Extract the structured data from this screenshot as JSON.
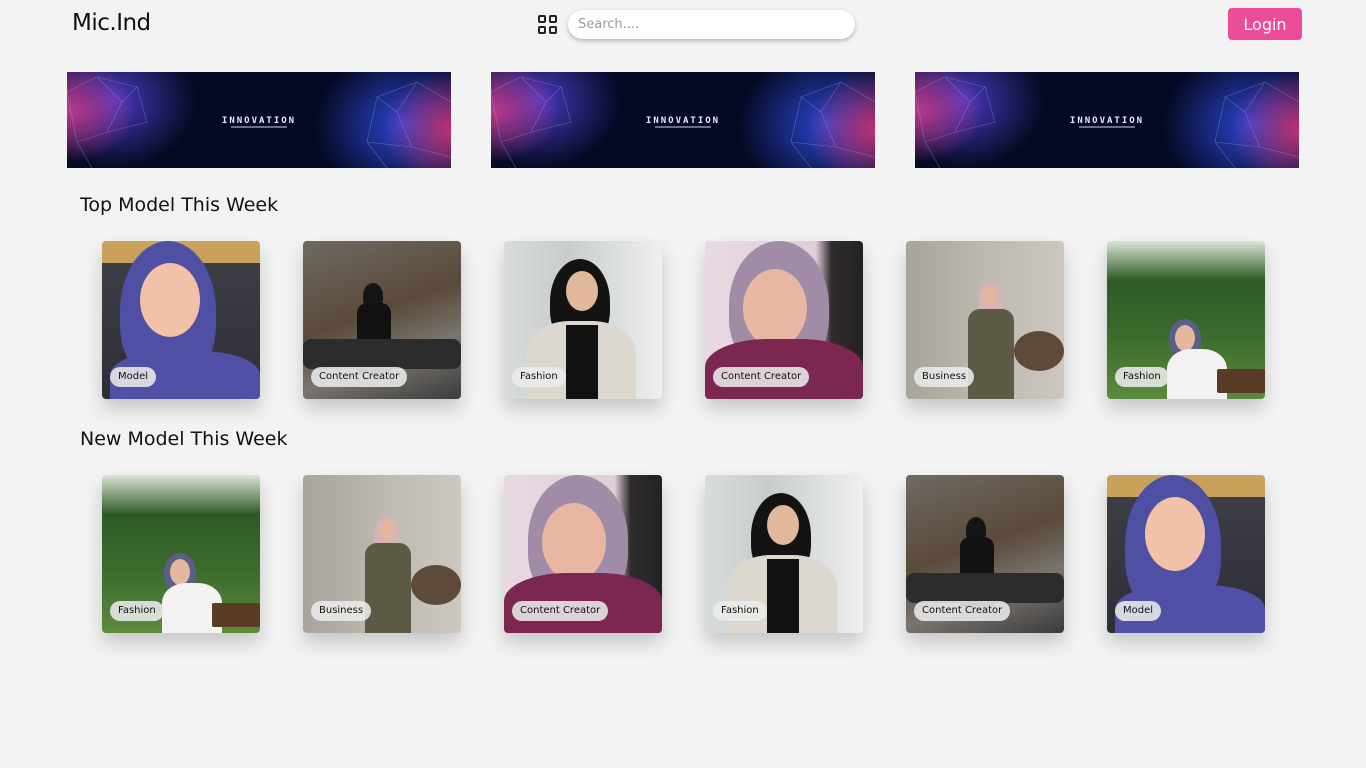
{
  "header": {
    "brand": "Mic.Ind",
    "search_placeholder": "Search....",
    "login_label": "Login",
    "grid_icon": "grid-icon"
  },
  "banners": [
    {
      "text": "INNOVATION"
    },
    {
      "text": "INNOVATION"
    },
    {
      "text": "INNOVATION"
    }
  ],
  "sections": {
    "top": {
      "title": "Top Model This Week",
      "cards": [
        {
          "tag": "Model"
        },
        {
          "tag": "Content Creator"
        },
        {
          "tag": "Fashion"
        },
        {
          "tag": "Content Creator"
        },
        {
          "tag": "Business"
        },
        {
          "tag": "Fashion"
        }
      ]
    },
    "new": {
      "title": "New Model This Week",
      "cards": [
        {
          "tag": "Fashion"
        },
        {
          "tag": "Business"
        },
        {
          "tag": "Content Creator"
        },
        {
          "tag": "Fashion"
        },
        {
          "tag": "Content Creator"
        },
        {
          "tag": "Model"
        }
      ]
    }
  },
  "colors": {
    "accent": "#ec4c98",
    "background": "#f3f3f3"
  }
}
